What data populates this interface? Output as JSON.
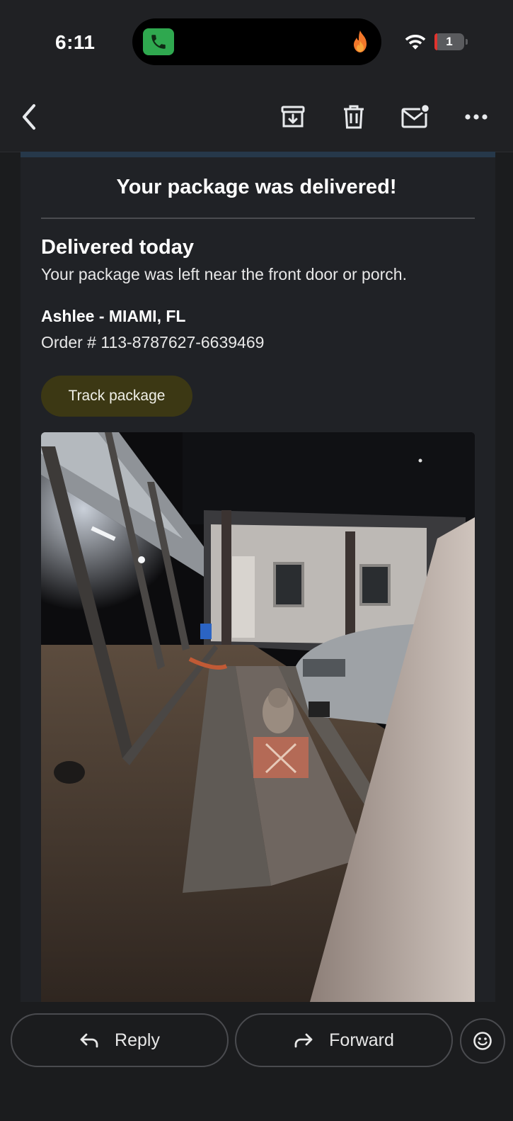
{
  "status_bar": {
    "time": "6:11",
    "battery_level": "1",
    "icons": [
      "phone-call-icon",
      "flame-icon",
      "wifi-icon",
      "battery-icon"
    ]
  },
  "toolbar": {
    "icons": [
      "back-icon",
      "archive-icon",
      "delete-icon",
      "mark-unread-icon",
      "more-icon"
    ]
  },
  "email": {
    "headline": "Your package was delivered!",
    "delivery_title": "Delivered today",
    "delivery_detail": "Your package was left near the front door or porch.",
    "recipient": "Ashlee - MIAMI, FL",
    "order": "Order # 113-8787627-6639469",
    "track_button": "Track package",
    "photo_icon": "delivery-photo"
  },
  "actions": {
    "reply": "Reply",
    "forward": "Forward",
    "icons": [
      "reply-icon",
      "forward-icon",
      "emoji-icon"
    ]
  },
  "colors": {
    "background": "#1b1c1e",
    "card": "#202226",
    "track_button": "#3c3814",
    "call_green": "#2fa84f",
    "battery_red": "#e0332e"
  }
}
